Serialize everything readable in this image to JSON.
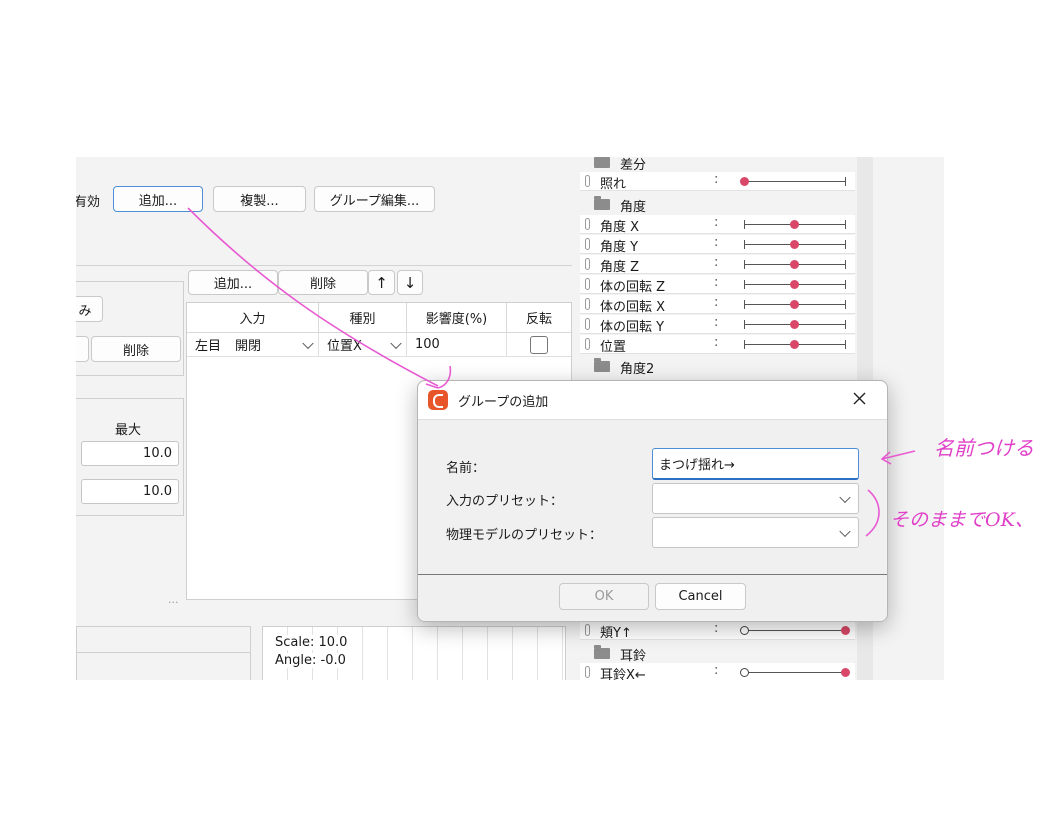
{
  "toolbar": {
    "enabled_label": "有効",
    "add_label": "追加...",
    "copy_label": "複製...",
    "group_edit_label": "グループ編集..."
  },
  "left": {
    "partial_button": "み",
    "delete_button": "削除",
    "max_header": "最大",
    "max_values": [
      "10.0",
      "10.0"
    ],
    "dots": "..."
  },
  "table_toolbar": {
    "add_label": "追加...",
    "delete_label": "削除",
    "up_label": "↑",
    "down_label": "↓"
  },
  "table": {
    "headers": [
      "入力",
      "種別",
      "影響度(%)",
      "反転"
    ],
    "row": {
      "input_name": "左目",
      "input_value": "開閉",
      "type": "位置X",
      "influence": "100"
    }
  },
  "viewport": {
    "scale": "Scale: 10.0",
    "angle": "Angle: -0.0"
  },
  "sidebar": {
    "group_diff": "差分",
    "row_shoumei": "照れ",
    "group_angle": "角度",
    "rows": [
      "角度 X",
      "角度 Y",
      "角度 Z",
      "体の回転 Z",
      "体の回転 X",
      "体の回転 Y",
      "位置"
    ],
    "group_angle2": "角度2",
    "row_cheek": "頬Y↑",
    "group_earring": "耳鈴",
    "row_earring": "耳鈴X←",
    "colon": ":",
    "slider_levels": {
      "照れ": 0.0,
      "角度 X": 0.5,
      "角度 Y": 0.5,
      "角度 Z": 0.5,
      "体の回転 Z": 0.5,
      "体の回転 X": 0.5,
      "体の回転 Y": 0.5,
      "位置": 0.5,
      "頬Y↑": 1.0,
      "耳鈴X←": 1.0
    },
    "accent_color": "#d94868"
  },
  "dialog": {
    "title": "グループの追加",
    "name_label": "名前：",
    "name_value": "まつげ揺れ→",
    "input_preset_label": "入力のプリセット：",
    "physics_preset_label": "物理モデルのプリセット：",
    "ok_label": "OK",
    "cancel_label": "Cancel"
  },
  "annotations": {
    "note1": "名前つける",
    "note2": "そのままでOK、"
  }
}
